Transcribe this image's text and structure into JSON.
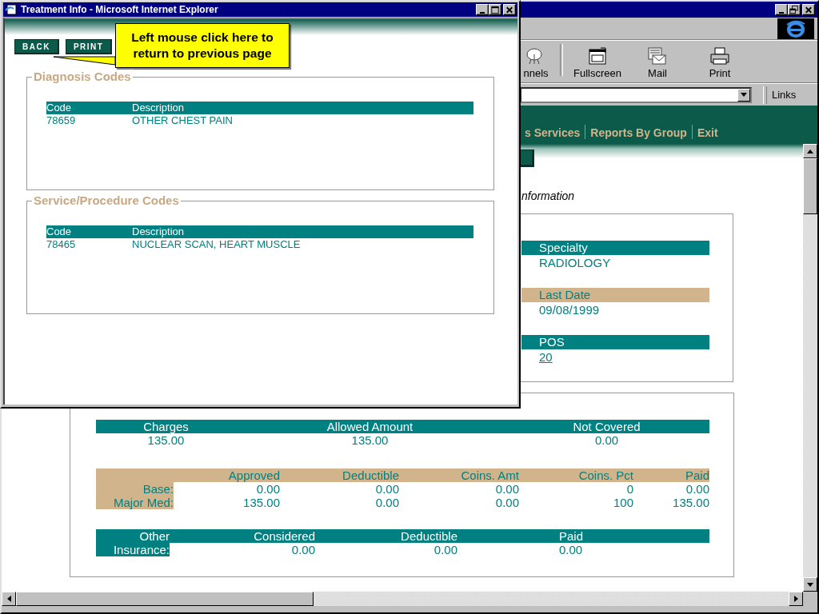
{
  "popup": {
    "title": "Treatment Info - Microsoft Internet Explorer",
    "buttons": [
      {
        "label": "BACK"
      },
      {
        "label": "PRINT"
      }
    ],
    "callout": "Left mouse click here to return to previous page",
    "code_sections": [
      {
        "legend": "Diagnosis Codes",
        "columns": [
          "Code",
          "Description"
        ],
        "rows": [
          [
            "78659",
            "OTHER CHEST PAIN"
          ]
        ]
      },
      {
        "legend": "Service/Procedure Codes",
        "columns": [
          "Code",
          "Description"
        ],
        "rows": [
          [
            "78465",
            "NUCLEAR SCAN, HEART MUSCLE"
          ]
        ]
      }
    ]
  },
  "browser": {
    "toolbar": [
      {
        "label": "nnels",
        "kind": "channels"
      },
      {
        "label": "Fullscreen",
        "kind": "fullscreen"
      },
      {
        "label": "Mail",
        "kind": "mail"
      },
      {
        "label": "Print",
        "kind": "print"
      }
    ],
    "links_label": "Links",
    "nav_links": [
      "s Services",
      "Reports By Group",
      "Exit"
    ],
    "section_heading": "nformation",
    "details": [
      {
        "label": "Specialty",
        "value": "RADIOLOGY",
        "color": "#008080",
        "kind": "text"
      },
      {
        "label": "Last Date",
        "value": "09/08/1999",
        "color": "#d2b48c",
        "kind": "text"
      },
      {
        "label": "POS",
        "value": "20",
        "color": "#008080",
        "kind": "link"
      }
    ],
    "charges": {
      "columns": [
        "Charges",
        "Allowed Amount",
        "Not Covered"
      ],
      "values": [
        "135.00",
        "135.00",
        "0.00"
      ]
    },
    "payments": {
      "columns": [
        "Approved",
        "Deductible",
        "Coins. Amt",
        "Coins. Pct",
        "Paid"
      ],
      "rows": [
        {
          "label": "Base:",
          "values": [
            "0.00",
            "0.00",
            "0.00",
            "0",
            "0.00"
          ]
        },
        {
          "label": "Major Med:",
          "values": [
            "135.00",
            "0.00",
            "0.00",
            "100",
            "135.00"
          ]
        }
      ]
    },
    "other_insurance": {
      "label": [
        "Other",
        "Insurance:"
      ],
      "columns": [
        "Considered",
        "Deductible",
        "Paid"
      ],
      "values": [
        "0.00",
        "0.00",
        "0.00"
      ]
    }
  }
}
